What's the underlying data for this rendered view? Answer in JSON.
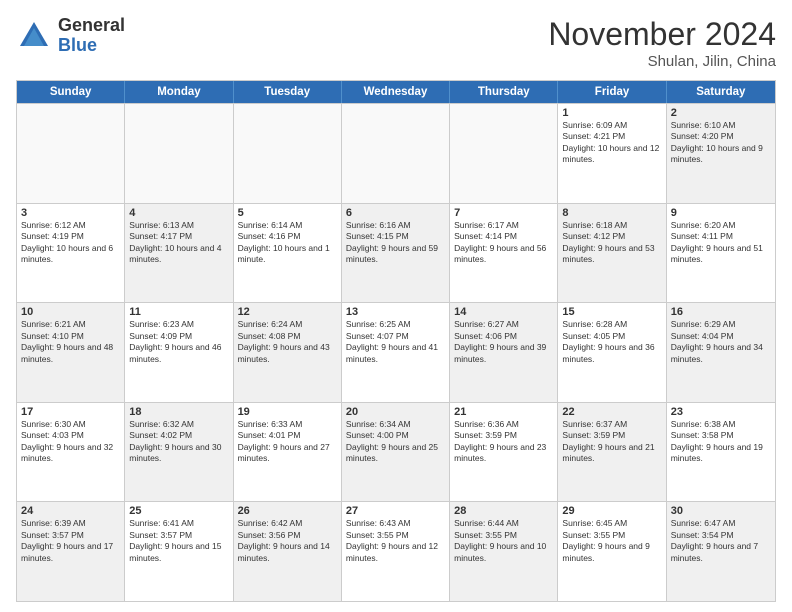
{
  "logo": {
    "general": "General",
    "blue": "Blue"
  },
  "header": {
    "month": "November 2024",
    "location": "Shulan, Jilin, China"
  },
  "weekdays": [
    "Sunday",
    "Monday",
    "Tuesday",
    "Wednesday",
    "Thursday",
    "Friday",
    "Saturday"
  ],
  "rows": [
    [
      {
        "day": "",
        "info": "",
        "empty": true
      },
      {
        "day": "",
        "info": "",
        "empty": true
      },
      {
        "day": "",
        "info": "",
        "empty": true
      },
      {
        "day": "",
        "info": "",
        "empty": true
      },
      {
        "day": "",
        "info": "",
        "empty": true
      },
      {
        "day": "1",
        "info": "Sunrise: 6:09 AM\nSunset: 4:21 PM\nDaylight: 10 hours and 12 minutes."
      },
      {
        "day": "2",
        "info": "Sunrise: 6:10 AM\nSunset: 4:20 PM\nDaylight: 10 hours and 9 minutes.",
        "shaded": true
      }
    ],
    [
      {
        "day": "3",
        "info": "Sunrise: 6:12 AM\nSunset: 4:19 PM\nDaylight: 10 hours and 6 minutes."
      },
      {
        "day": "4",
        "info": "Sunrise: 6:13 AM\nSunset: 4:17 PM\nDaylight: 10 hours and 4 minutes.",
        "shaded": true
      },
      {
        "day": "5",
        "info": "Sunrise: 6:14 AM\nSunset: 4:16 PM\nDaylight: 10 hours and 1 minute."
      },
      {
        "day": "6",
        "info": "Sunrise: 6:16 AM\nSunset: 4:15 PM\nDaylight: 9 hours and 59 minutes.",
        "shaded": true
      },
      {
        "day": "7",
        "info": "Sunrise: 6:17 AM\nSunset: 4:14 PM\nDaylight: 9 hours and 56 minutes."
      },
      {
        "day": "8",
        "info": "Sunrise: 6:18 AM\nSunset: 4:12 PM\nDaylight: 9 hours and 53 minutes.",
        "shaded": true
      },
      {
        "day": "9",
        "info": "Sunrise: 6:20 AM\nSunset: 4:11 PM\nDaylight: 9 hours and 51 minutes."
      }
    ],
    [
      {
        "day": "10",
        "info": "Sunrise: 6:21 AM\nSunset: 4:10 PM\nDaylight: 9 hours and 48 minutes.",
        "shaded": true
      },
      {
        "day": "11",
        "info": "Sunrise: 6:23 AM\nSunset: 4:09 PM\nDaylight: 9 hours and 46 minutes."
      },
      {
        "day": "12",
        "info": "Sunrise: 6:24 AM\nSunset: 4:08 PM\nDaylight: 9 hours and 43 minutes.",
        "shaded": true
      },
      {
        "day": "13",
        "info": "Sunrise: 6:25 AM\nSunset: 4:07 PM\nDaylight: 9 hours and 41 minutes."
      },
      {
        "day": "14",
        "info": "Sunrise: 6:27 AM\nSunset: 4:06 PM\nDaylight: 9 hours and 39 minutes.",
        "shaded": true
      },
      {
        "day": "15",
        "info": "Sunrise: 6:28 AM\nSunset: 4:05 PM\nDaylight: 9 hours and 36 minutes."
      },
      {
        "day": "16",
        "info": "Sunrise: 6:29 AM\nSunset: 4:04 PM\nDaylight: 9 hours and 34 minutes.",
        "shaded": true
      }
    ],
    [
      {
        "day": "17",
        "info": "Sunrise: 6:30 AM\nSunset: 4:03 PM\nDaylight: 9 hours and 32 minutes."
      },
      {
        "day": "18",
        "info": "Sunrise: 6:32 AM\nSunset: 4:02 PM\nDaylight: 9 hours and 30 minutes.",
        "shaded": true
      },
      {
        "day": "19",
        "info": "Sunrise: 6:33 AM\nSunset: 4:01 PM\nDaylight: 9 hours and 27 minutes."
      },
      {
        "day": "20",
        "info": "Sunrise: 6:34 AM\nSunset: 4:00 PM\nDaylight: 9 hours and 25 minutes.",
        "shaded": true
      },
      {
        "day": "21",
        "info": "Sunrise: 6:36 AM\nSunset: 3:59 PM\nDaylight: 9 hours and 23 minutes."
      },
      {
        "day": "22",
        "info": "Sunrise: 6:37 AM\nSunset: 3:59 PM\nDaylight: 9 hours and 21 minutes.",
        "shaded": true
      },
      {
        "day": "23",
        "info": "Sunrise: 6:38 AM\nSunset: 3:58 PM\nDaylight: 9 hours and 19 minutes."
      }
    ],
    [
      {
        "day": "24",
        "info": "Sunrise: 6:39 AM\nSunset: 3:57 PM\nDaylight: 9 hours and 17 minutes.",
        "shaded": true
      },
      {
        "day": "25",
        "info": "Sunrise: 6:41 AM\nSunset: 3:57 PM\nDaylight: 9 hours and 15 minutes."
      },
      {
        "day": "26",
        "info": "Sunrise: 6:42 AM\nSunset: 3:56 PM\nDaylight: 9 hours and 14 minutes.",
        "shaded": true
      },
      {
        "day": "27",
        "info": "Sunrise: 6:43 AM\nSunset: 3:55 PM\nDaylight: 9 hours and 12 minutes."
      },
      {
        "day": "28",
        "info": "Sunrise: 6:44 AM\nSunset: 3:55 PM\nDaylight: 9 hours and 10 minutes.",
        "shaded": true
      },
      {
        "day": "29",
        "info": "Sunrise: 6:45 AM\nSunset: 3:55 PM\nDaylight: 9 hours and 9 minutes."
      },
      {
        "day": "30",
        "info": "Sunrise: 6:47 AM\nSunset: 3:54 PM\nDaylight: 9 hours and 7 minutes.",
        "shaded": true
      }
    ]
  ]
}
